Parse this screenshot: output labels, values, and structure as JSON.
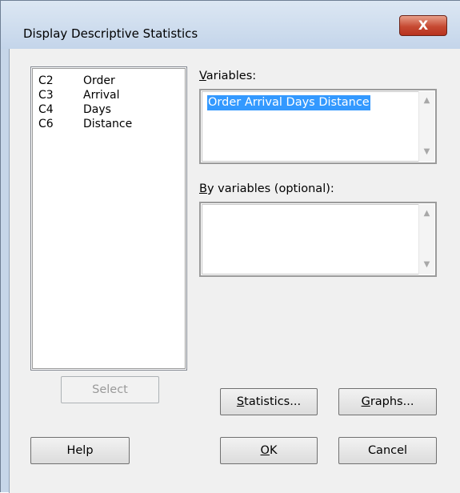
{
  "window": {
    "title": "Display Descriptive Statistics",
    "close_glyph": "X"
  },
  "columns_list": {
    "items": [
      {
        "col": "C2",
        "name": "Order"
      },
      {
        "col": "C3",
        "name": "Arrival"
      },
      {
        "col": "C4",
        "name": "Days"
      },
      {
        "col": "C6",
        "name": "Distance"
      }
    ]
  },
  "variables": {
    "label_mnemonic": "V",
    "label_rest": "ariables:",
    "value": "Order Arrival Days Distance"
  },
  "by_variables": {
    "label_mnemonic": "B",
    "label_rest": "y variables (optional):",
    "value": ""
  },
  "buttons": {
    "select": "Select",
    "statistics_mnemonic": "S",
    "statistics_rest": "tatistics...",
    "graphs_mnemonic": "G",
    "graphs_rest": "raphs...",
    "help": "Help",
    "ok_mnemonic": "O",
    "ok_rest": "K",
    "cancel": "Cancel"
  }
}
